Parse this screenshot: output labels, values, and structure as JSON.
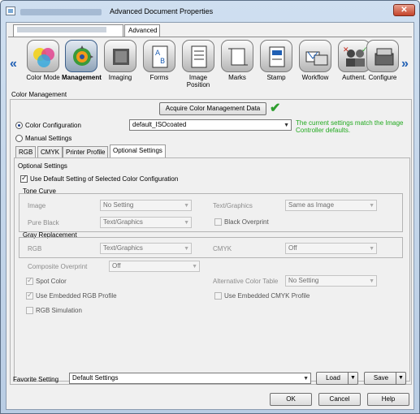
{
  "window": {
    "title": "Advanced Document Properties",
    "close_label": "✕"
  },
  "tabs": {
    "advanced": "Advanced"
  },
  "ribbon": {
    "items": [
      {
        "label": "Color Mode",
        "icon": "color-mode-icon"
      },
      {
        "label": "Management",
        "icon": "management-icon"
      },
      {
        "label": "Imaging",
        "icon": "imaging-icon"
      },
      {
        "label": "Forms",
        "icon": "forms-icon"
      },
      {
        "label": "Image Position",
        "icon": "image-position-icon"
      },
      {
        "label": "Marks",
        "icon": "marks-icon"
      },
      {
        "label": "Stamp",
        "icon": "stamp-icon"
      },
      {
        "label": "Workflow",
        "icon": "workflow-icon"
      },
      {
        "label": "Authent.",
        "icon": "authentication-icon"
      },
      {
        "label": "Configure",
        "icon": "configure-icon"
      }
    ],
    "prev": "«",
    "next": "»"
  },
  "color_management": {
    "title": "Color Management",
    "acquire_button": "Acquire Color Management Data",
    "color_configuration_label": "Color Configuration",
    "color_configuration_value": "default_ISOcoated",
    "manual_settings_label": "Manual Settings",
    "status_message": "The current settings match the Image Controller defaults."
  },
  "subtabs": [
    "RGB",
    "CMYK",
    "Printer Profile",
    "Optional Settings"
  ],
  "optional": {
    "title": "Optional Settings",
    "use_default_label": "Use Default Setting of Selected Color Configuration",
    "tone_curve_title": "Tone Curve",
    "image_label": "Image",
    "image_value": "No Setting",
    "text_graphics_label": "Text/Graphics",
    "text_graphics_value": "Same as Image",
    "pure_black_label": "Pure Black",
    "pure_black_value": "Text/Graphics",
    "black_overprint_label": "Black Overprint",
    "gray_replacement_title": "Gray Replacement",
    "rgb_label": "RGB",
    "rgb_value": "Text/Graphics",
    "cmyk_label": "CMYK",
    "cmyk_value": "Off",
    "composite_overprint_label": "Composite Overprint",
    "composite_overprint_value": "Off",
    "spot_color_label": "Spot Color",
    "alt_color_table_label": "Alternative Color Table",
    "alt_color_table_value": "No Setting",
    "embedded_rgb_label": "Use Embedded RGB Profile",
    "embedded_cmyk_label": "Use Embedded CMYK Profile",
    "rgb_simulation_label": "RGB Simulation"
  },
  "favorite": {
    "label": "Favorite Setting",
    "value": "Default Settings",
    "load": "Load",
    "save": "Save"
  },
  "footer": {
    "ok": "OK",
    "cancel": "Cancel",
    "help": "Help"
  },
  "colors": {
    "accent": "#1f5fb4",
    "status_green": "#21a91e"
  }
}
